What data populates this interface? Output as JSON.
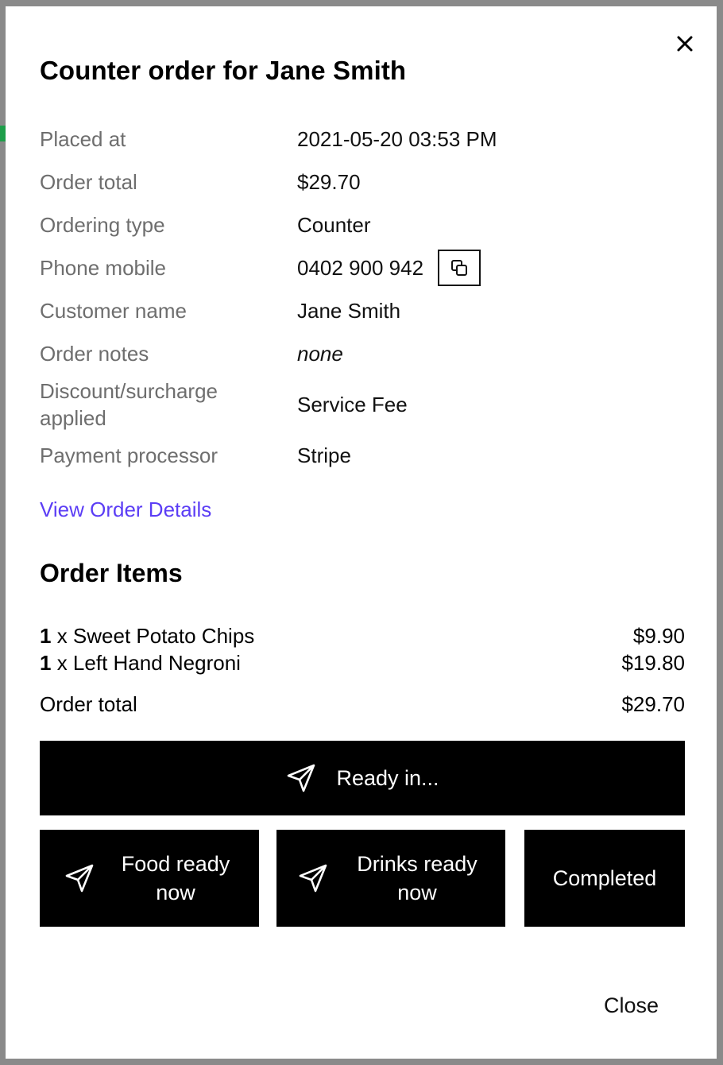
{
  "modal": {
    "title": "Counter order for Jane Smith",
    "close_icon": "close-icon"
  },
  "details": {
    "placed_at": {
      "label": "Placed at",
      "value": "2021-05-20 03:53 PM"
    },
    "order_total": {
      "label": "Order total",
      "value": "$29.70"
    },
    "ordering_type": {
      "label": "Ordering type",
      "value": "Counter"
    },
    "phone_mobile": {
      "label": "Phone mobile",
      "value": "0402 900 942",
      "copy_icon": "copy-icon"
    },
    "customer_name": {
      "label": "Customer name",
      "value": "Jane Smith"
    },
    "order_notes": {
      "label": "Order notes",
      "value": "none"
    },
    "discount": {
      "label_line1": "Discount/surcharge",
      "label_line2": "applied",
      "value": "Service Fee"
    },
    "payment_processor": {
      "label": "Payment processor",
      "value": "Stripe"
    }
  },
  "view_order_details": "View Order Details",
  "order_items": {
    "heading": "Order Items",
    "items": [
      {
        "qty": "1",
        "sep": " x ",
        "name": "Sweet Potato Chips",
        "price": "$9.90"
      },
      {
        "qty": "1",
        "sep": " x ",
        "name": "Left Hand Negroni",
        "price": "$19.80"
      }
    ],
    "total_label": "Order total",
    "total_value": "$29.70"
  },
  "actions": {
    "ready_in": "Ready in...",
    "food_ready_line1": "Food ready",
    "food_ready_line2": "now",
    "drinks_ready_line1": "Drinks ready",
    "drinks_ready_line2": "now",
    "completed": "Completed",
    "send_icon": "paper-plane-icon"
  },
  "footer": {
    "close": "Close"
  },
  "colors": {
    "backdrop": "#8a8a8a",
    "link": "#5b3df5",
    "label": "#6e6e6e",
    "button_bg": "#000000",
    "accent_green": "#1e9e4a"
  }
}
